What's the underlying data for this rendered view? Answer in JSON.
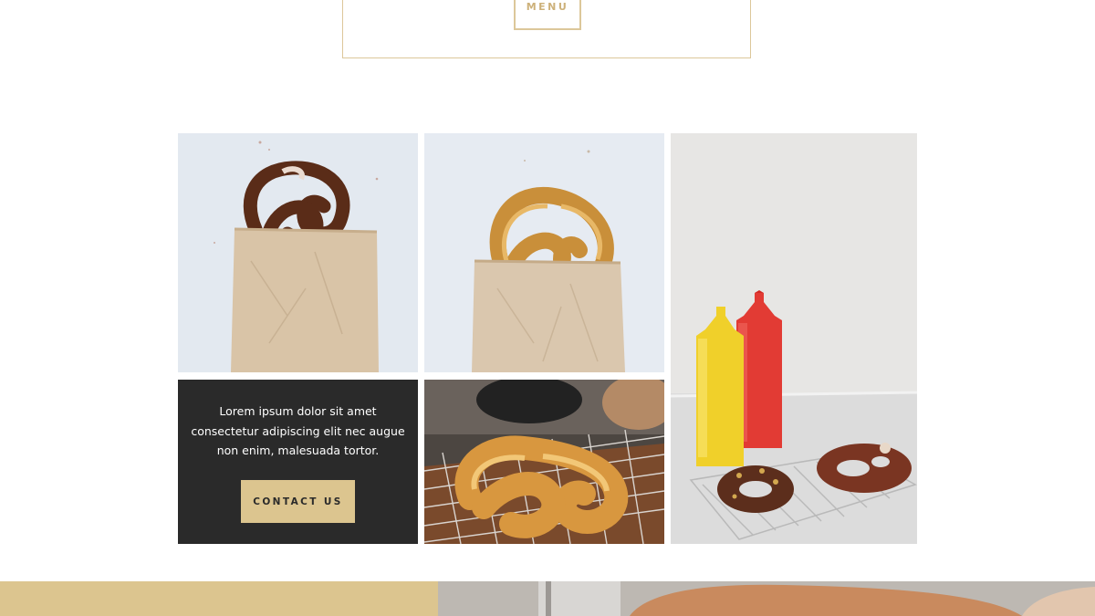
{
  "header": {
    "menu_label": "MENU"
  },
  "gallery": {
    "items": [
      {
        "image": "pretzel-in-paper-bag-dark"
      },
      {
        "image": "pretzel-in-paper-bag-golden"
      },
      {
        "image": "pretzels-with-mustard-ketchup"
      },
      {
        "image": "pretzel-on-cooling-rack"
      }
    ]
  },
  "promo": {
    "lines": [
      "Lorem ipsum dolor sit amet",
      "consectetur adipiscing elit nec augue",
      "non enim, malesuada tortor."
    ],
    "cta_label": "CONTACT US"
  },
  "colors": {
    "accent_gold": "#dcc58f",
    "frame_gold": "#dcc79a",
    "dark_panel": "#2a2a2a"
  }
}
